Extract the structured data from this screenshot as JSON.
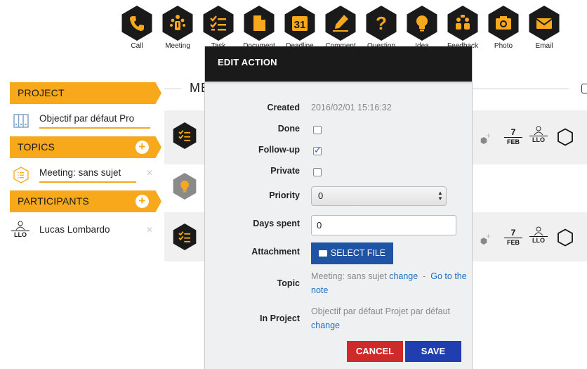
{
  "toolbar": {
    "items": [
      {
        "label": "Call",
        "icon": "phone-icon"
      },
      {
        "label": "Meeting",
        "icon": "meeting-icon"
      },
      {
        "label": "Task",
        "icon": "task-icon"
      },
      {
        "label": "Document",
        "icon": "document-icon"
      },
      {
        "label": "Deadline",
        "icon": "calendar-31-icon"
      },
      {
        "label": "Comment",
        "icon": "pen-icon"
      },
      {
        "label": "Question",
        "icon": "question-icon"
      },
      {
        "label": "Idea",
        "icon": "lightbulb-icon"
      },
      {
        "label": "Feedback",
        "icon": "feedback-icon"
      },
      {
        "label": "Photo",
        "icon": "camera-icon"
      },
      {
        "label": "Email",
        "icon": "envelope-icon"
      }
    ],
    "deadline_number": "31"
  },
  "sidebar": {
    "project": {
      "heading": "PROJECT",
      "item": "Objectif par défaut Pro"
    },
    "topics": {
      "heading": "TOPICS",
      "item": "Meeting: sans sujet"
    },
    "participants": {
      "heading": "PARTICIPANTS",
      "item": "Lucas Lombardo",
      "avatar_initials": "LLO"
    }
  },
  "main": {
    "title": "ME",
    "rows": [
      {
        "date_day": "7",
        "date_month": "FEB",
        "user": "LLO"
      },
      {
        "date_day": "7",
        "date_month": "FEB",
        "user": "LLO"
      }
    ]
  },
  "modal": {
    "title": "EDIT ACTION",
    "created_label": "Created",
    "created_value": "2016/02/01 15:16:32",
    "done_label": "Done",
    "done_checked": false,
    "followup_label": "Follow-up",
    "followup_checked": true,
    "private_label": "Private",
    "private_checked": false,
    "priority_label": "Priority",
    "priority_value": "0",
    "days_spent_label": "Days spent",
    "days_spent_value": "0",
    "attachment_label": "Attachment",
    "select_file_label": "SELECT FILE",
    "topic_label": "Topic",
    "topic_value": "Meeting: sans sujet",
    "topic_change": "change",
    "topic_separator": "-",
    "topic_goto": "Go to the note",
    "in_project_label": "In Project",
    "in_project_value": "Objectif par défaut Projet par défaut",
    "in_project_change": "change",
    "cancel_label": "CANCEL",
    "save_label": "SAVE"
  },
  "colors": {
    "accent": "#f7a81b",
    "dark": "#1a1a1a",
    "cancel": "#cf2a2a",
    "save": "#1f3fb0",
    "link": "#1e6fc2"
  }
}
